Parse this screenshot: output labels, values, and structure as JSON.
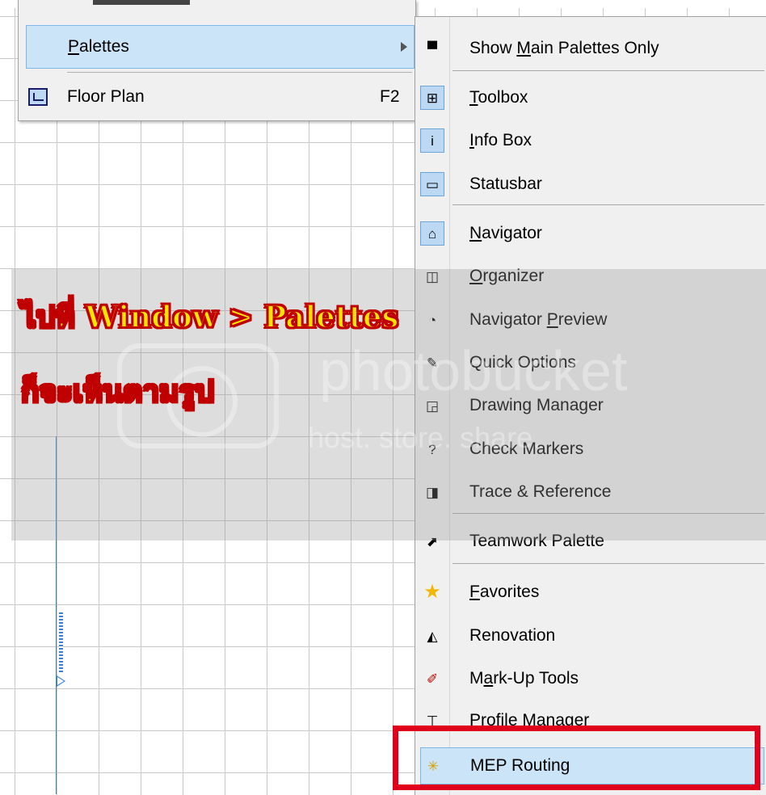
{
  "left_menu": {
    "items": [
      {
        "label_pre": "",
        "label_u": "P",
        "label_post": "alettes",
        "shortcut": ""
      },
      {
        "label_pre": "Floor Plan",
        "label_u": "",
        "label_post": "",
        "shortcut": "F2"
      }
    ]
  },
  "submenu": {
    "items": [
      {
        "pre": "Show ",
        "u": "M",
        "post": "ain Palettes Only",
        "icon": "main-palettes-icon",
        "glyph": "▀"
      },
      {
        "pre": "",
        "u": "T",
        "post": "oolbox",
        "icon": "toolbox-icon",
        "glyph": "⊞"
      },
      {
        "pre": "",
        "u": "I",
        "post": "nfo Box",
        "icon": "info-box-icon",
        "glyph": "i"
      },
      {
        "pre": "Statusbar",
        "u": "",
        "post": "",
        "icon": "statusbar-icon",
        "glyph": "▭"
      },
      {
        "pre": "",
        "u": "N",
        "post": "avigator",
        "icon": "navigator-icon",
        "glyph": "⌂"
      },
      {
        "pre": "",
        "u": "O",
        "post": "rganizer",
        "icon": "organizer-icon",
        "glyph": "◫"
      },
      {
        "pre": "Navigator ",
        "u": "P",
        "post": "review",
        "icon": "navigator-preview-icon",
        "glyph": "◔"
      },
      {
        "pre": "Quick Options",
        "u": "",
        "post": "",
        "icon": "quick-options-icon",
        "glyph": "✎"
      },
      {
        "pre": "Drawing Manager",
        "u": "",
        "post": "",
        "icon": "drawing-manager-icon",
        "glyph": "◲"
      },
      {
        "pre": "Check Markers",
        "u": "",
        "post": "",
        "icon": "check-markers-icon",
        "glyph": "?"
      },
      {
        "pre": "Trace & Reference",
        "u": "",
        "post": "",
        "icon": "trace-reference-icon",
        "glyph": "◨"
      },
      {
        "pre": "Teamwork Palette",
        "u": "",
        "post": "",
        "icon": "teamwork-palette-icon",
        "glyph": "⬈"
      },
      {
        "pre": "",
        "u": "F",
        "post": "avorites",
        "icon": "favorites-star-icon",
        "glyph": "★"
      },
      {
        "pre": "Renovation",
        "u": "",
        "post": "",
        "icon": "renovation-icon",
        "glyph": "◭"
      },
      {
        "pre": "M",
        "u": "a",
        "post": "rk-Up Tools",
        "icon": "markup-tools-icon",
        "glyph": "✐"
      },
      {
        "pre": "Profile Manager",
        "u": "",
        "post": "",
        "icon": "profile-manager-icon",
        "glyph": "⊤"
      },
      {
        "pre": "MEP Routing",
        "u": "",
        "post": "",
        "icon": "mep-routing-icon",
        "glyph": "✳"
      }
    ]
  },
  "annotation": {
    "line1": "ไปที่  Window > Palettes",
    "line2": "ก็จะเห็นตามรูป"
  },
  "watermark": {
    "text": "photobucket",
    "sub": "host. store. share."
  },
  "colors": {
    "highlight": "#cce4f7",
    "highlight_border": "#7fb4e6",
    "red_frame": "#e0001b",
    "annotation_fill": "#ffe600",
    "annotation_stroke": "#c00000"
  }
}
